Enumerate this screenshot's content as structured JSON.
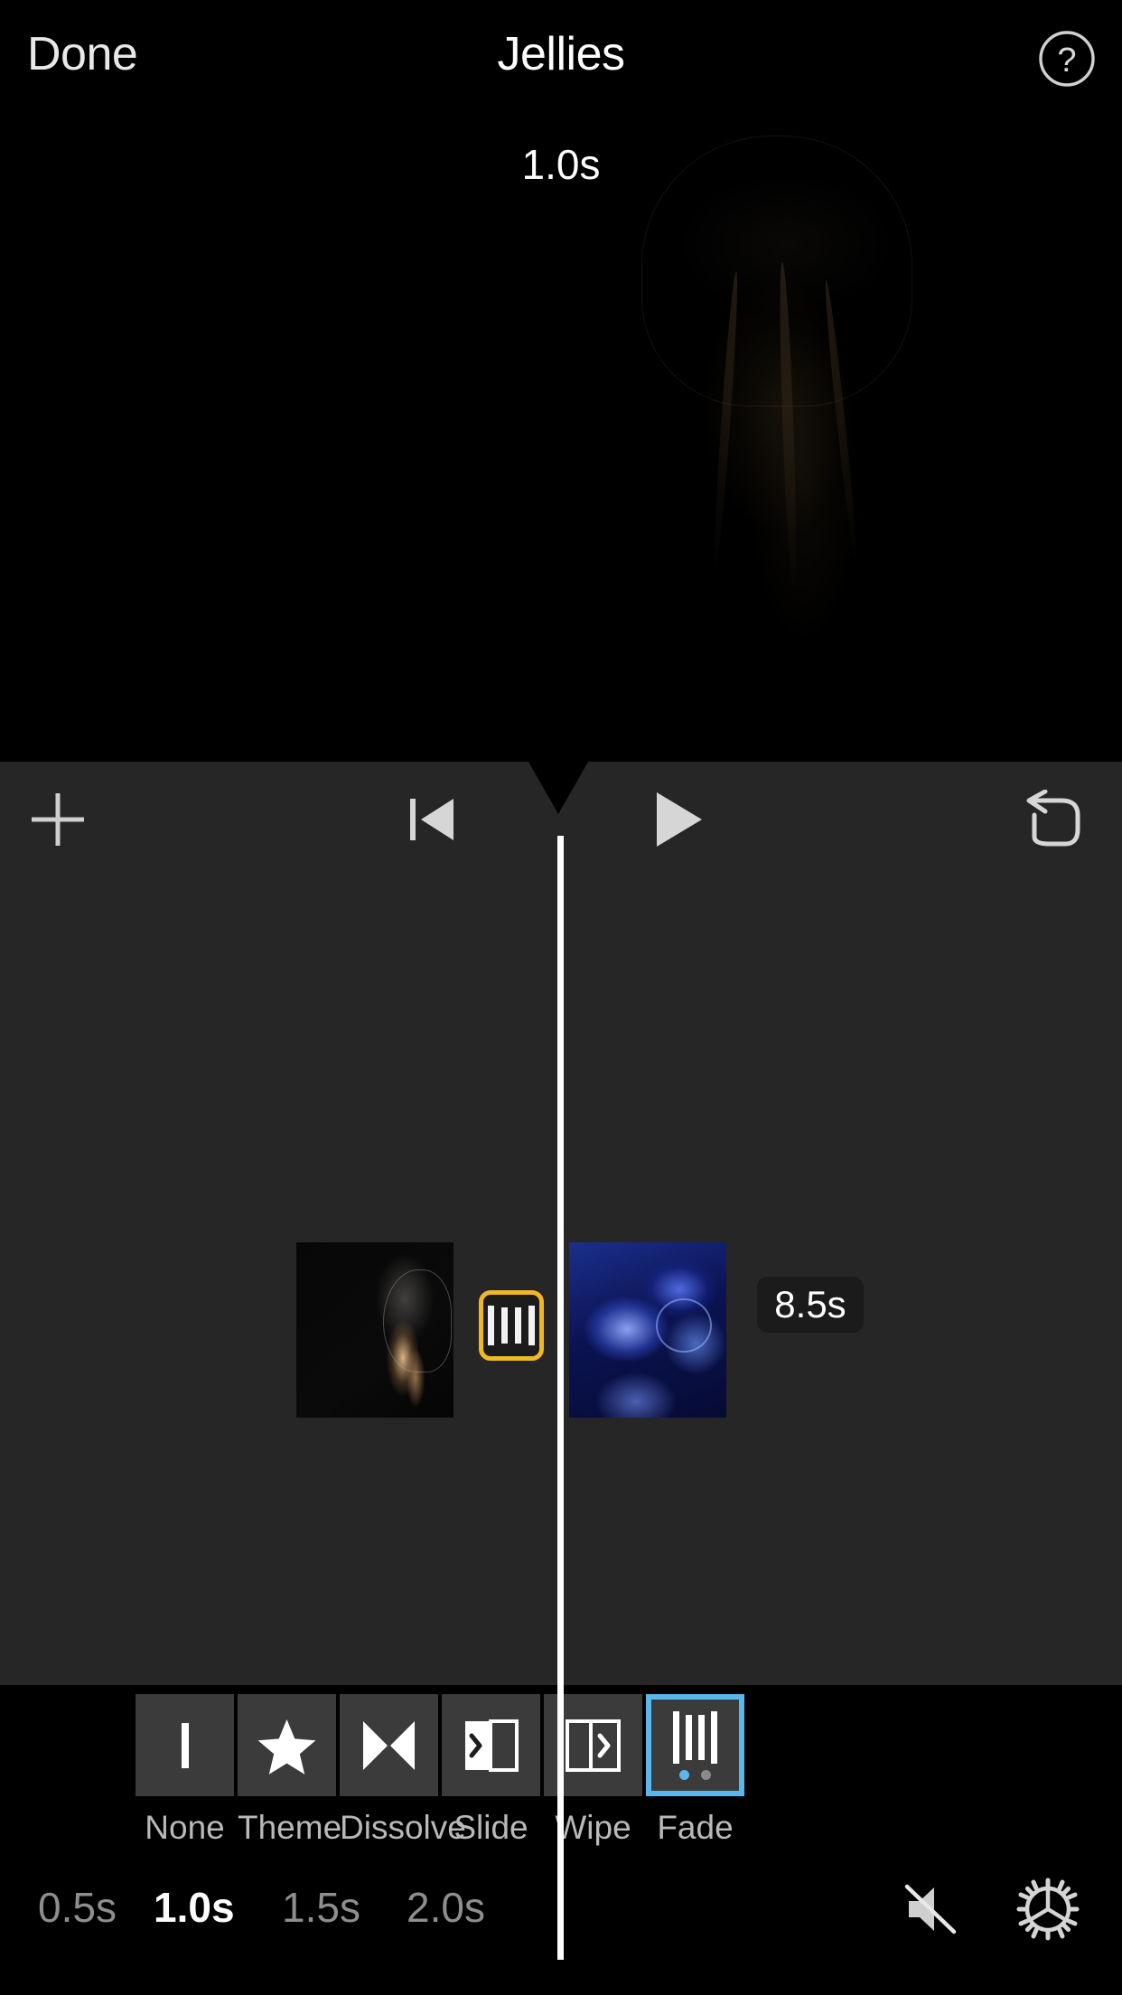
{
  "nav": {
    "done_label": "Done",
    "title": "Jellies",
    "help_icon": "help-circle-icon"
  },
  "viewer": {
    "transition_duration_overlay": "1.0s",
    "frame_description": "jellyfish-preview-frame"
  },
  "timeline": {
    "toolbar": {
      "add_icon": "plus-icon",
      "skip_back_icon": "skip-to-start-icon",
      "play_icon": "play-icon",
      "undo_icon": "undo-icon"
    },
    "playhead": "playhead-line",
    "clips": [
      {
        "name": "clip-1",
        "thumb": "jellyfish-orange-thumbnail"
      },
      {
        "name": "clip-2",
        "thumb": "jellyfish-blue-thumbnail"
      }
    ],
    "transition_badge": {
      "icon": "fade-transition-icon",
      "selected": true,
      "border_color": "#f2b824"
    },
    "clip_duration_badge": "8.5s"
  },
  "bottom": {
    "transitions": [
      {
        "label": "None",
        "icon": "none-bar-icon",
        "selected": false
      },
      {
        "label": "Theme",
        "icon": "star-icon",
        "selected": false
      },
      {
        "label": "Dissolve",
        "icon": "dissolve-bowtie-icon",
        "selected": false
      },
      {
        "label": "Slide",
        "icon": "slide-icon",
        "selected": false
      },
      {
        "label": "Wipe",
        "icon": "wipe-icon",
        "selected": false
      },
      {
        "label": "Fade",
        "icon": "fade-bars-icon",
        "selected": true
      }
    ],
    "page_dots": {
      "count": 2,
      "active_index": 0,
      "active_color": "#59b7ec",
      "inactive_color": "#8a8a8a"
    },
    "selection_color": "#59b7ec",
    "durations": [
      {
        "label": "0.5s",
        "selected": false
      },
      {
        "label": "1.0s",
        "selected": true
      },
      {
        "label": "1.5s",
        "selected": false
      },
      {
        "label": "2.0s",
        "selected": false
      }
    ],
    "mute_icon": "speaker-mute-icon",
    "settings_icon": "gear-icon"
  }
}
